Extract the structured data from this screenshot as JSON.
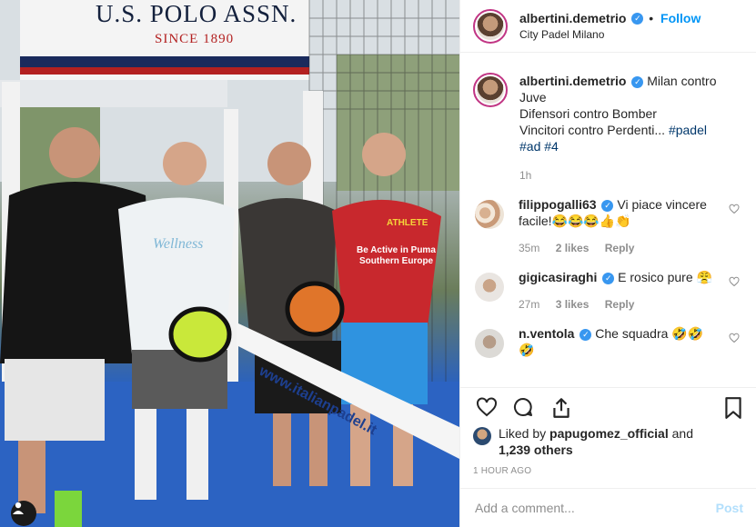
{
  "photo": {
    "banner_title": "U.S. POLO ASSN.",
    "banner_subtitle": "SINCE 1890",
    "net_text": "www.italianpadel.it",
    "shirt_line1": "ATHLETE",
    "shirt_line2": "Be Active in Puma",
    "shirt_line3": "Southern Europe",
    "shirt_left": "Wellness",
    "user_icon": "user-silhouette-icon"
  },
  "header": {
    "username": "albertini.demetrio",
    "verified_icon": "verified-badge-icon",
    "separator": "•",
    "follow_label": "Follow",
    "location": "City Padel Milano"
  },
  "caption": {
    "username": "albertini.demetrio",
    "text_line1": "Milan contro",
    "text_line2": "Juve",
    "text_line3": "Difensori contro Bomber",
    "text_line4": "Vincitori contro Perdenti...",
    "hashtag1": "#padel",
    "hashtag2": "#ad",
    "hashtag3": "#4",
    "time": "1h"
  },
  "comments": [
    {
      "username": "filippogalli63",
      "text": "Vi piace vincere facile!😂😂😂👍👏",
      "time": "35m",
      "likes": "2 likes",
      "reply": "Reply"
    },
    {
      "username": "gigicasiraghi",
      "text": "E rosico pure 😤",
      "time": "27m",
      "likes": "3 likes",
      "reply": "Reply"
    },
    {
      "username": "n.ventola",
      "text": "Che squadra 🤣🤣🤣",
      "time": "",
      "likes": "",
      "reply": ""
    }
  ],
  "likes": {
    "prefix": "Liked by",
    "user": "papugomez_official",
    "middle": "and",
    "others": "1,239 others"
  },
  "time_ago": "1 HOUR AGO",
  "add_comment": {
    "placeholder": "Add a comment...",
    "post_label": "Post"
  },
  "colors": {
    "link": "#0095f6",
    "verified": "#3897f0",
    "muted": "#8e8e8e",
    "story_ring": "#c13584",
    "post_disabled": "#b2dffc"
  }
}
